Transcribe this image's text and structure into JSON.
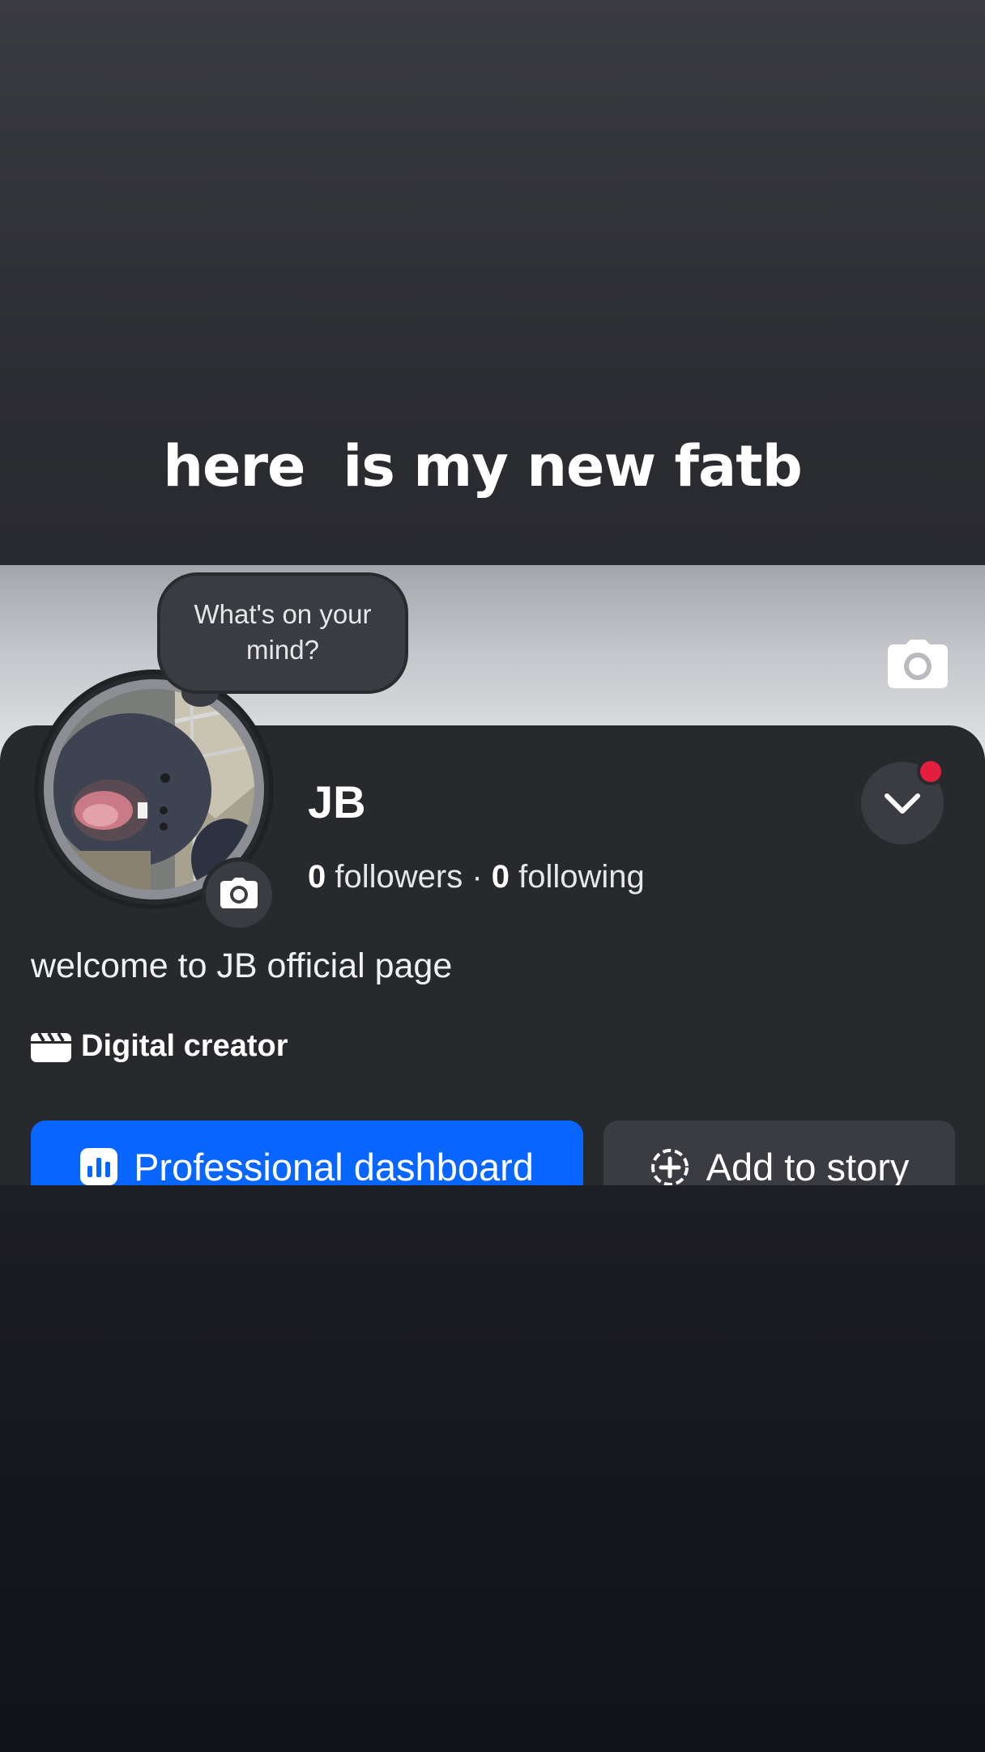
{
  "overlay": {
    "caption": "here  is my new fatb"
  },
  "profile": {
    "status_prompt": "What's on your mind?",
    "name": "JB",
    "followers_count": "0",
    "followers_label": " followers",
    "separator": " · ",
    "following_count": "0",
    "following_label": " following",
    "bio": "welcome to JB official page",
    "category": "Digital creator",
    "category_icon": "clapperboard-icon",
    "notification_color": "#e41e3f"
  },
  "actions": {
    "primary_label": "Professional dashboard",
    "primary_icon": "bar-chart-icon",
    "primary_color": "#0866ff",
    "secondary_label": "Add to story",
    "secondary_icon": "add-circle-icon"
  },
  "icons": {
    "cover_camera": "camera-icon",
    "avatar_camera": "camera-icon",
    "profile_menu": "chevron-down-icon"
  }
}
